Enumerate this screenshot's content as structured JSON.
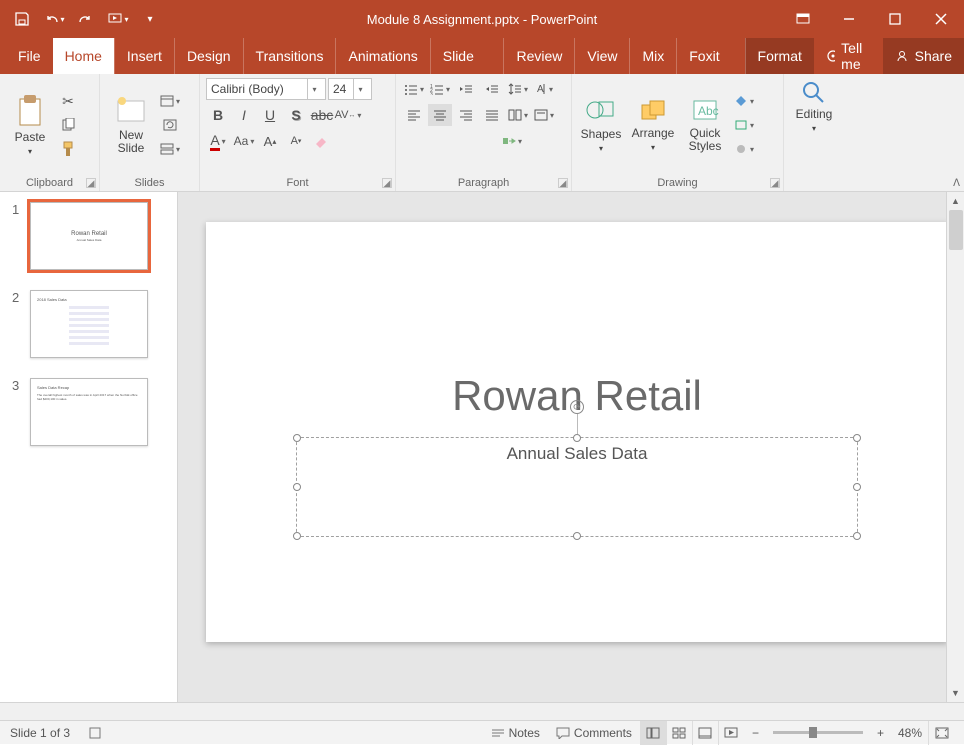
{
  "title": "Module 8 Assignment.pptx - PowerPoint",
  "tabs": {
    "file": "File",
    "home": "Home",
    "insert": "Insert",
    "design": "Design",
    "transitions": "Transitions",
    "animations": "Animations",
    "slideshow": "Slide Show",
    "review": "Review",
    "view": "View",
    "mix": "Mix",
    "foxit": "Foxit PDF",
    "format": "Format",
    "tellme": "Tell me",
    "share": "Share"
  },
  "groups": {
    "clipboard": "Clipboard",
    "slides": "Slides",
    "font": "Font",
    "paragraph": "Paragraph",
    "drawing": "Drawing",
    "editing": "Editing"
  },
  "buttons": {
    "paste": "Paste",
    "newslide": "New\nSlide",
    "shapes": "Shapes",
    "arrange": "Arrange",
    "quickstyles": "Quick\nStyles",
    "editing": "Editing"
  },
  "font": {
    "name": "Calibri (Body)",
    "size": "24"
  },
  "slide": {
    "title": "Rowan Retail",
    "subtitle": "Annual Sales Data"
  },
  "thumbs": {
    "s1_title": "Rowan Retail",
    "s2_title": "2018 Sales Data",
    "s3_title": "Sales Data Recap",
    "s3_body": "The overall highest month of sales was in April 2017 when the Norfolk office had $200,100 in sales."
  },
  "status": {
    "slideinfo": "Slide 1 of 3",
    "notes": "Notes",
    "comments": "Comments",
    "zoom": "48%"
  }
}
